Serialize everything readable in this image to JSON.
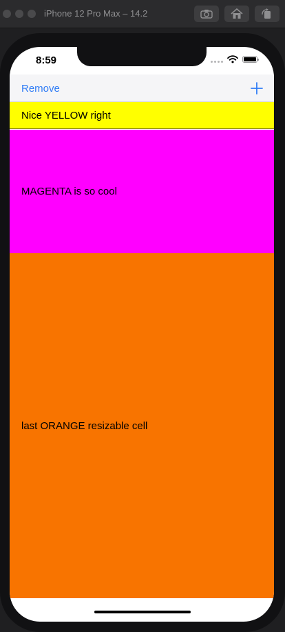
{
  "simulator": {
    "title": "iPhone 12 Pro Max – 14.2",
    "buttons": [
      "screenshot-icon",
      "home-icon",
      "rotate-icon"
    ]
  },
  "status_bar": {
    "time": "8:59",
    "icons": [
      "signal-icon",
      "wifi-icon",
      "battery-icon"
    ]
  },
  "nav": {
    "left_label": "Remove",
    "right_icon": "plus-icon",
    "tint": "#2f7cf6"
  },
  "cells": [
    {
      "label": "Nice YELLOW right",
      "color": "#ffff00"
    },
    {
      "label": "MAGENTA is so cool",
      "color": "#ff00ff"
    },
    {
      "label": "last ORANGE resizable cell",
      "color": "#f87400"
    }
  ]
}
